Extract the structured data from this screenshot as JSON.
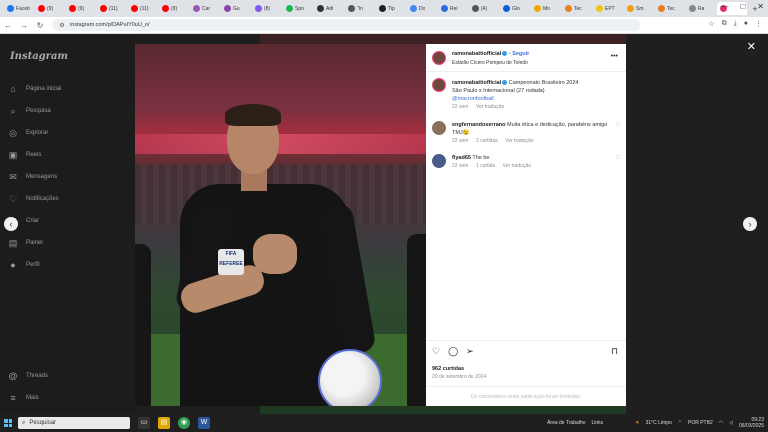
{
  "browser": {
    "tabs": [
      {
        "label": "Faceb",
        "color": "#1877f2"
      },
      {
        "label": "(9)",
        "color": "#ff0000"
      },
      {
        "label": "(9)",
        "color": "#ff0000"
      },
      {
        "label": "(11)",
        "color": "#ff0000"
      },
      {
        "label": "(11)",
        "color": "#ff0000"
      },
      {
        "label": "(9)",
        "color": "#ff0000"
      },
      {
        "label": "Car",
        "color": "#9b59b6"
      },
      {
        "label": "Gu",
        "color": "#8e44ad"
      },
      {
        "label": "(8)",
        "color": "#7f5af0"
      },
      {
        "label": "Spo",
        "color": "#1db954"
      },
      {
        "label": "Adi",
        "color": "#333333"
      },
      {
        "label": "\"In",
        "color": "#555555"
      },
      {
        "label": "Tip",
        "color": "#222222"
      },
      {
        "label": "Do",
        "color": "#4285f4"
      },
      {
        "label": "Rei",
        "color": "#2d6cdf"
      },
      {
        "label": "(4)",
        "color": "#555555"
      },
      {
        "label": "Glo",
        "color": "#0b5ed7"
      },
      {
        "label": "Mo",
        "color": "#f0a500"
      },
      {
        "label": "Tec",
        "color": "#e67e22"
      },
      {
        "label": "EPT",
        "color": "#f1c40f"
      },
      {
        "label": "Sm",
        "color": "#f39c12"
      },
      {
        "label": "Tec",
        "color": "#e67e22"
      },
      {
        "label": "Ra",
        "color": "#7f8c8d"
      },
      {
        "label": "",
        "color": "#e1306c"
      }
    ],
    "new_tab": "+",
    "url": "instagram.com/p/DAPuIY0uU_o/",
    "window_controls": [
      "—",
      "□",
      "✕"
    ]
  },
  "sidebar": {
    "logo": "Instagram",
    "items": [
      {
        "label": "Página inicial",
        "icon": "⌂",
        "icon_name": "home-icon"
      },
      {
        "label": "Pesquisa",
        "icon": "⌕",
        "icon_name": "search-icon"
      },
      {
        "label": "Explorar",
        "icon": "◎",
        "icon_name": "compass-icon"
      },
      {
        "label": "Reels",
        "icon": "▣",
        "icon_name": "reels-icon"
      },
      {
        "label": "Mensagens",
        "icon": "✉",
        "icon_name": "messenger-icon"
      },
      {
        "label": "Notificações",
        "icon": "♡",
        "icon_name": "heart-icon"
      },
      {
        "label": "Criar",
        "icon": "⊞",
        "icon_name": "create-icon"
      },
      {
        "label": "Painel",
        "icon": "▤",
        "icon_name": "dashboard-icon"
      },
      {
        "label": "Perfil",
        "icon": "●",
        "icon_name": "profile-icon"
      }
    ],
    "bottom_items": [
      {
        "label": "Threads",
        "icon": "@",
        "icon_name": "threads-icon"
      },
      {
        "label": "Mais",
        "icon": "≡",
        "icon_name": "menu-icon"
      }
    ]
  },
  "post": {
    "author": "ramonabattiofficial",
    "follow": "Seguir",
    "location": "Estádio Cícero Pompeu de Toledo",
    "caption_prefix": "Campeonato Brasileiro 2024",
    "caption_line2": "São Paulo x Internacional (27 rodada)",
    "caption_mention": "@macronfootball",
    "caption_time": "22 sem",
    "see_translation": "Ver tradução",
    "comments": [
      {
        "user": "engfernandoserrano",
        "text": "Muita ética e dedicação, parabéns amigo TMJ😉",
        "time": "22 sem",
        "likes": "2 curtidas",
        "translate": "Ver tradução"
      },
      {
        "user": "flyad65",
        "text": "The be",
        "time": "22 sem",
        "likes": "1 curtida",
        "translate": "Ver tradução"
      }
    ],
    "likes": "962 curtidas",
    "date": "20 de setembro de 2024",
    "comments_disabled": "Os comentários nesta publicação foram limitados."
  },
  "photo": {
    "badge_text": "FIFA REFEREE"
  },
  "taskbar": {
    "search_placeholder": "Pesquisar",
    "weather": "31°C  Limpo",
    "lang": "POR PTB2",
    "time": "09:23",
    "date": "06/03/2025",
    "area_label": "Área de Trabalho",
    "links_label": "Links"
  },
  "colors": {
    "accent_blue": "#3897f0",
    "instagram_pink": "#e1306c"
  }
}
